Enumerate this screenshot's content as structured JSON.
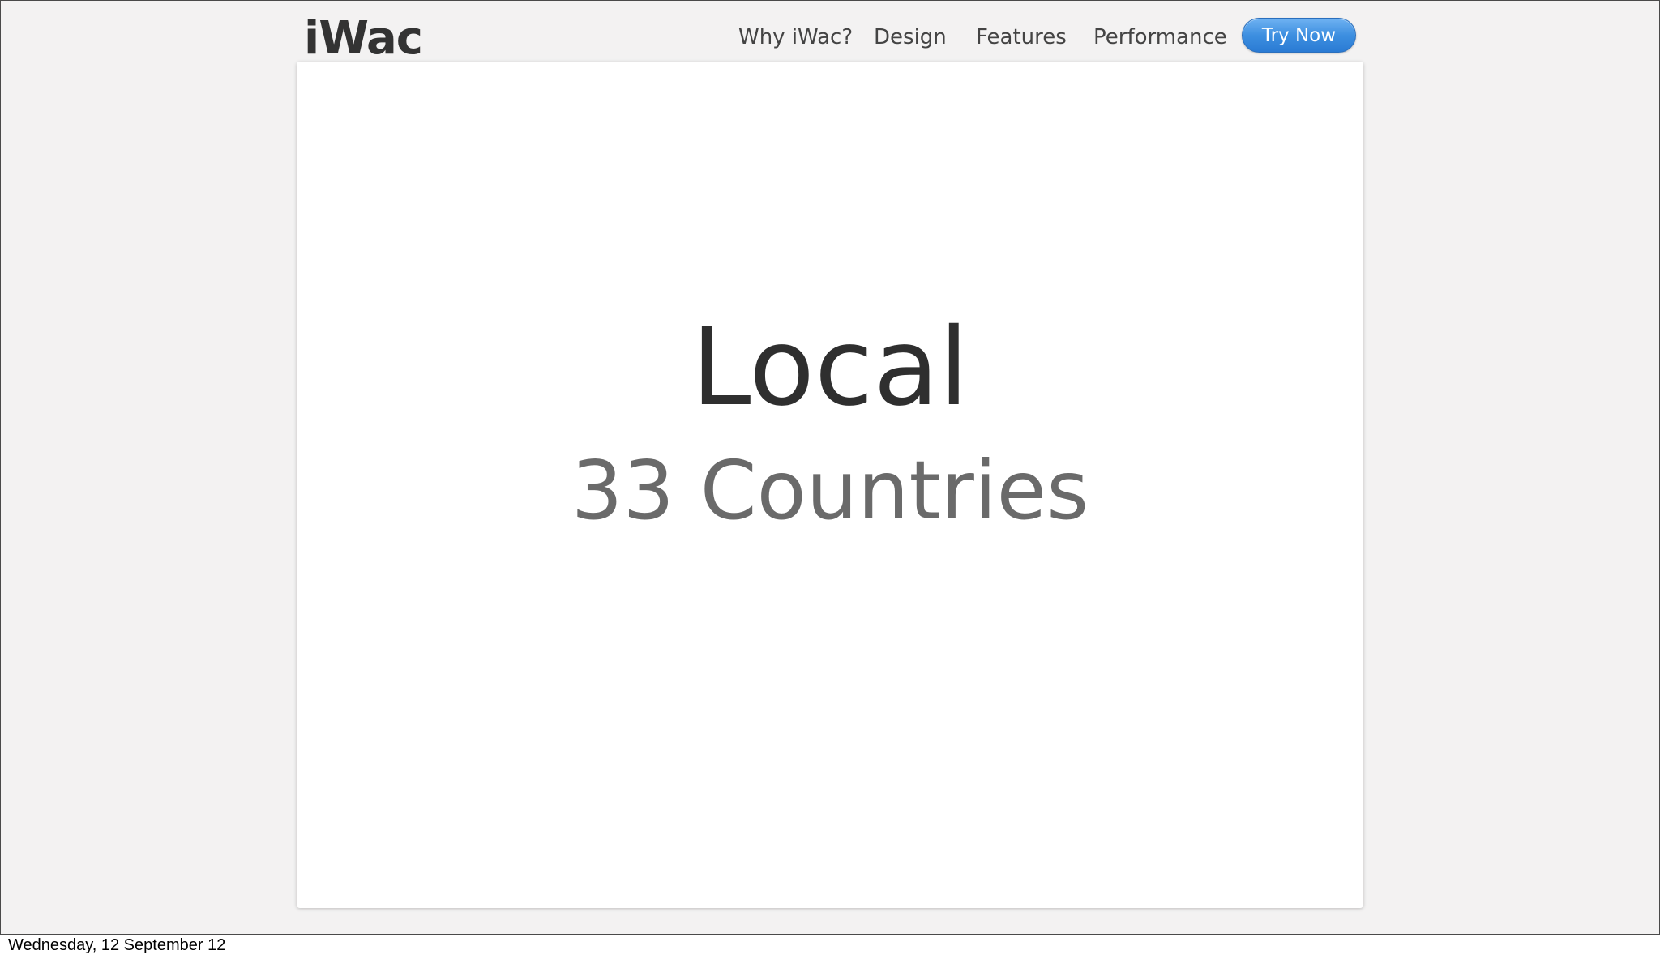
{
  "header": {
    "logo": "iWac",
    "nav": [
      {
        "label": "Why iWac?"
      },
      {
        "label": "Design"
      },
      {
        "label": "Features"
      },
      {
        "label": "Performance"
      }
    ],
    "cta_label": "Try Now"
  },
  "main": {
    "headline": "Local",
    "subhead": "33 Countries"
  },
  "footer": {
    "date": "Wednesday, 12 September 12"
  },
  "colors": {
    "background": "#f3f2f2",
    "panel": "#ffffff",
    "headline": "#2f2f2f",
    "subhead": "#6a6a6a",
    "button_blue": "#3d8fe0"
  }
}
